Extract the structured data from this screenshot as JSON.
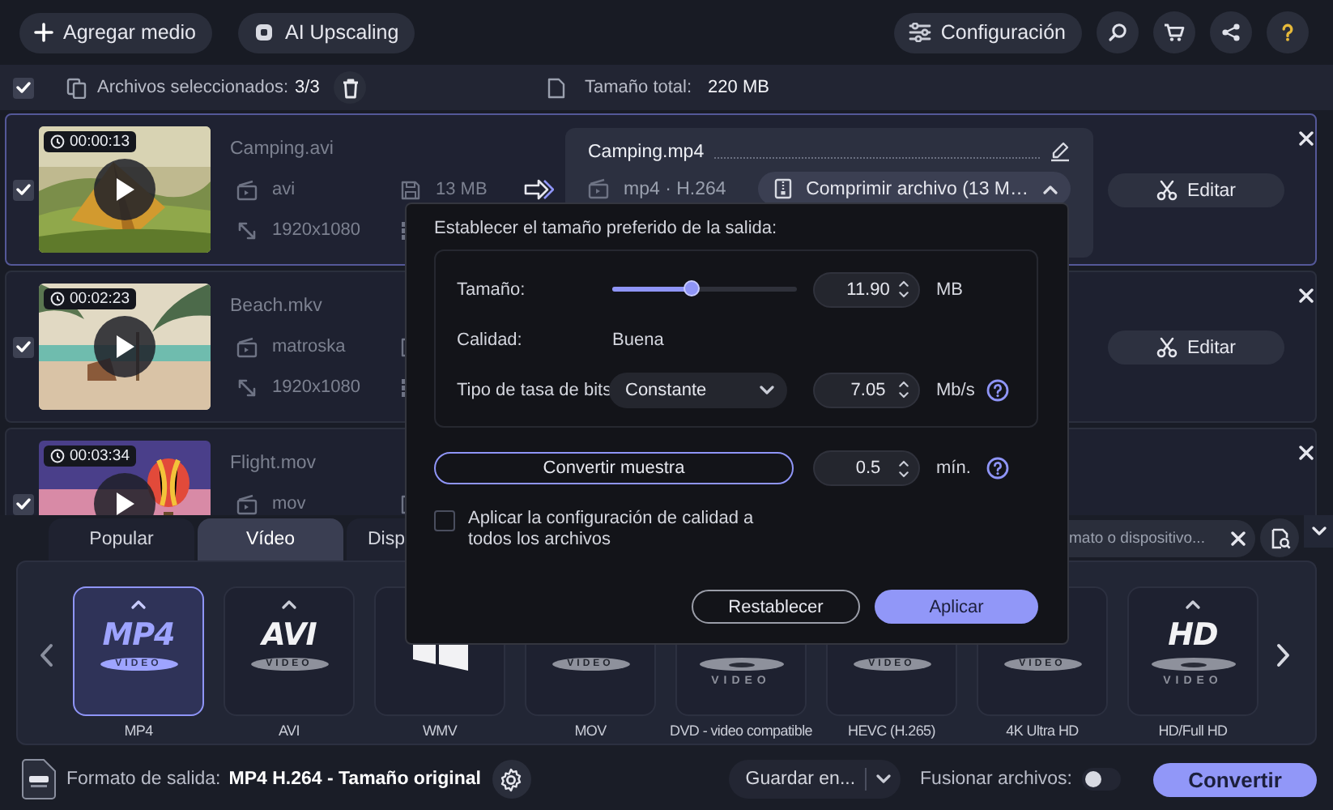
{
  "toolbar": {
    "buttons": [
      "Agregar medio",
      "AI Upscaling"
    ],
    "settings": "Configuración"
  },
  "selection": {
    "checked": true,
    "label": "Archivos seleccionados:",
    "count": "3/3",
    "total_label": "Tamaño total:",
    "total": "220 MB"
  },
  "files": [
    {
      "checked": true,
      "selected": true,
      "duration": "00:00:13",
      "name": "Camping.avi",
      "format": "avi",
      "size": "13 MB",
      "resolution": "1920x1080",
      "output": {
        "name": "Camping.mp4",
        "format": "mp4 · H.264",
        "compression": "Comprimir archivo (13 M…"
      },
      "edit": "Editar"
    },
    {
      "checked": true,
      "selected": false,
      "duration": "00:02:23",
      "name": "Beach.mkv",
      "format": "matroska",
      "resolution": "1920x1080",
      "edit": "Editar"
    },
    {
      "checked": true,
      "selected": false,
      "duration": "00:03:34",
      "name": "Flight.mov",
      "format": "mov"
    }
  ],
  "formats": {
    "tabs": [
      {
        "label": "Popular",
        "selected": false
      },
      {
        "label": "Vídeo",
        "selected": true
      },
      {
        "label": "Disp",
        "selected": false
      }
    ],
    "search": {
      "placeholder": "mato o dispositivo..."
    },
    "items": [
      {
        "kind": "pill",
        "logo": "MP4",
        "sub": "VIDEO",
        "label": "MP4",
        "selected": true
      },
      {
        "kind": "pill",
        "logo": "AVI",
        "sub": "VIDEO",
        "label": "AVI",
        "selected": false
      },
      {
        "kind": "windows",
        "label": "WMV",
        "selected": false
      },
      {
        "kind": "pill",
        "sub": "VIDEO",
        "label": "MOV",
        "selected": false
      },
      {
        "kind": "disc",
        "sub": "VIDEO",
        "label": "DVD - video compatible",
        "selected": false
      },
      {
        "kind": "pill",
        "sub": "VIDEO",
        "label": "HEVC (H.265)",
        "selected": false
      },
      {
        "kind": "pill",
        "sub": "VIDEO",
        "label": "4K Ultra HD",
        "selected": false
      },
      {
        "kind": "disc",
        "logo": "HD",
        "sub": "VIDEO",
        "label": "HD/Full HD",
        "selected": false
      }
    ]
  },
  "popup": {
    "title": "Establecer el tamaño preferido de la salida:",
    "size_label": "Tamaño:",
    "level": 0.43,
    "size": "11.90",
    "size_unit": "MB",
    "quality_label": "Calidad:",
    "quality": "Buena",
    "bitrate_label": "Tipo de tasa de bits",
    "bitrate_type": "Constante",
    "bitrate": "7.05",
    "bitrate_unit": "Mb/s",
    "sample_button": "Convertir muestra",
    "sample": "0.5",
    "sample_unit": "mín.",
    "apply_all": {
      "checked": false,
      "label": "Aplicar la configuración de calidad a todos los archivos"
    },
    "reset": "Restablecer",
    "apply": "Aplicar"
  },
  "bottom": {
    "output_label": "Formato de salida:",
    "output": "MP4 H.264 - Tamaño original",
    "save": "Guardar en...",
    "merge": {
      "label": "Fusionar archivos:",
      "on": false
    },
    "convert": "Convertir"
  }
}
